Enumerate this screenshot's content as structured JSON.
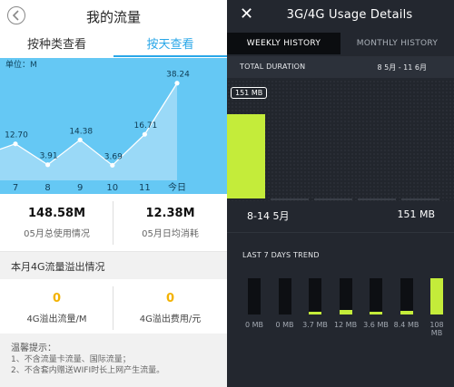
{
  "left": {
    "title": "我的流量",
    "tabs": [
      {
        "label": "按种类查看",
        "active": false
      },
      {
        "label": "按天查看",
        "active": true
      }
    ],
    "unit_label": "单位：M",
    "chart_data": {
      "type": "area",
      "categories": [
        "7",
        "8",
        "9",
        "10",
        "11",
        "今日"
      ],
      "values": [
        12.7,
        3.91,
        14.38,
        3.69,
        16.71,
        38.24
      ],
      "value_labels": [
        "12.70",
        "3.91",
        "14.38",
        "3.69",
        "16.71",
        "38.24"
      ],
      "ylim": [
        0,
        45
      ],
      "fill_color": "#9ad9f7",
      "background_color": "#65c8f4"
    },
    "stats": [
      {
        "value": "148.58M",
        "label": "05月总使用情况"
      },
      {
        "value": "12.38M",
        "label": "05月日均消耗"
      }
    ],
    "section_title": "本月4G流量溢出情况",
    "overflow": [
      {
        "value": "0",
        "label": "4G溢出流量/M"
      },
      {
        "value": "0",
        "label": "4G溢出费用/元"
      }
    ],
    "tips": {
      "title": "温馨提示：",
      "lines": [
        "1、不含流量卡流量、国际流量；",
        "2、不含套内赠送WIFI时长上网产生流量。"
      ]
    },
    "accent_color": "#2aa7e8",
    "overflow_color": "#f3b200"
  },
  "right": {
    "close_glyph": "✕",
    "title": "3G/4G Usage Details",
    "tabs": [
      {
        "label": "WEEKLY HISTORY",
        "active": true
      },
      {
        "label": "MONTHLY HISTORY",
        "active": false
      }
    ],
    "total_label": "TOTAL DURATION",
    "date_range": "8 5月 - 11 6月",
    "week": {
      "tag": "151 MB",
      "range": "8-14 5月",
      "value": "151 MB",
      "fill_fraction": 0.62
    },
    "trend_label": "LAST 7 DAYS TREND",
    "trend": [
      {
        "label": "0 MB",
        "level": 0.0
      },
      {
        "label": "0 MB",
        "level": 0.0
      },
      {
        "label": "3.7 MB",
        "level": 0.06
      },
      {
        "label": "12 MB",
        "level": 0.11
      },
      {
        "label": "3.6 MB",
        "level": 0.06
      },
      {
        "label": "8.4 MB",
        "level": 0.08
      },
      {
        "label": "108 MB",
        "level": 1.0
      }
    ],
    "accent_color": "#c4ec3a"
  }
}
